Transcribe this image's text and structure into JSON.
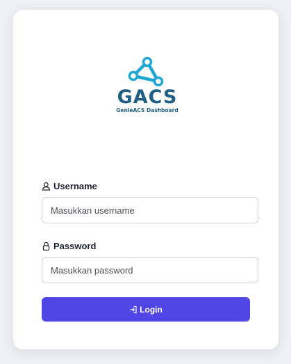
{
  "logo": {
    "title": "GACS",
    "subtitle": "GenieACS Dashboard",
    "icon": "network-triangle-icon"
  },
  "form": {
    "username": {
      "label": "Username",
      "icon": "user-icon",
      "placeholder": "Masukkan username",
      "value": ""
    },
    "password": {
      "label": "Password",
      "icon": "lock-icon",
      "placeholder": "Masukkan password",
      "value": ""
    },
    "submit": {
      "label": "Login",
      "icon": "sign-in-icon"
    }
  },
  "colors": {
    "page_background": "#eef1f5",
    "card_background": "#ffffff",
    "brand": "#1f5e85",
    "logo_accent": "#1ea7d6",
    "button": "#4f46e5"
  }
}
